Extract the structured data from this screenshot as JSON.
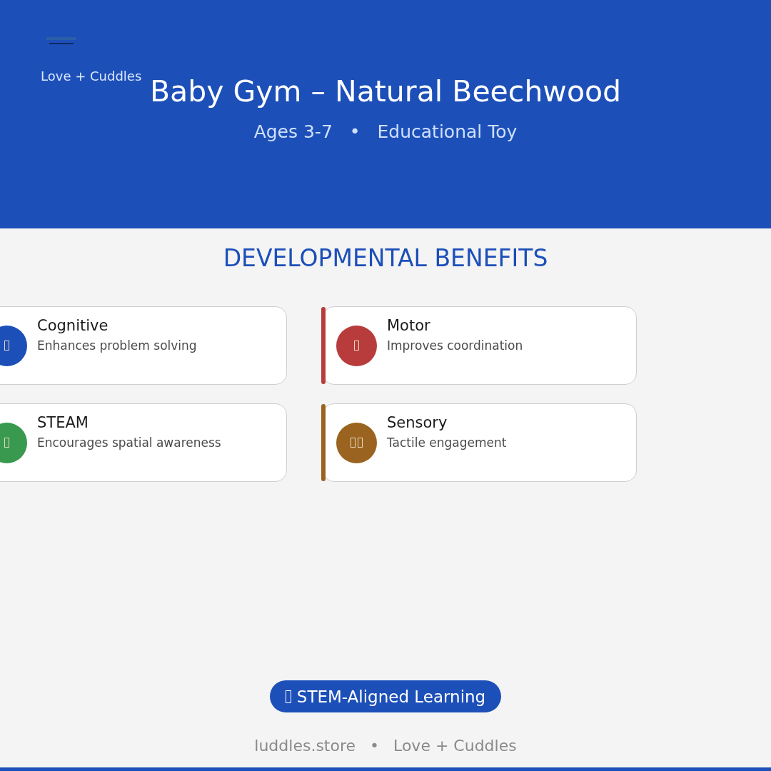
{
  "header": {
    "brand": "Love + Cuddles",
    "title": "Baby Gym – Natural Beechwood",
    "subtitle": [
      "Ages 3-7",
      "•",
      "Educational Toy"
    ]
  },
  "section": {
    "heading": "DEVELOPMENTAL BENEFITS"
  },
  "benefits": [
    {
      "title": "Cognitive",
      "text": "Enhances problem solving",
      "color": "#1c4fb8",
      "kind": "single"
    },
    {
      "title": "Motor",
      "text": "Improves coordination",
      "color": "#b83c3c",
      "kind": "single"
    },
    {
      "title": "STEAM",
      "text": "Encourages spatial awareness",
      "color": "#38994f",
      "kind": "single"
    },
    {
      "title": "Sensory",
      "text": "Tactile engagement",
      "color": "#9a6420",
      "kind": "double"
    }
  ],
  "badge": {
    "label": "STEM-Aligned Learning"
  },
  "footer": [
    "luddles.store",
    "•",
    "Love + Cuddles"
  ]
}
